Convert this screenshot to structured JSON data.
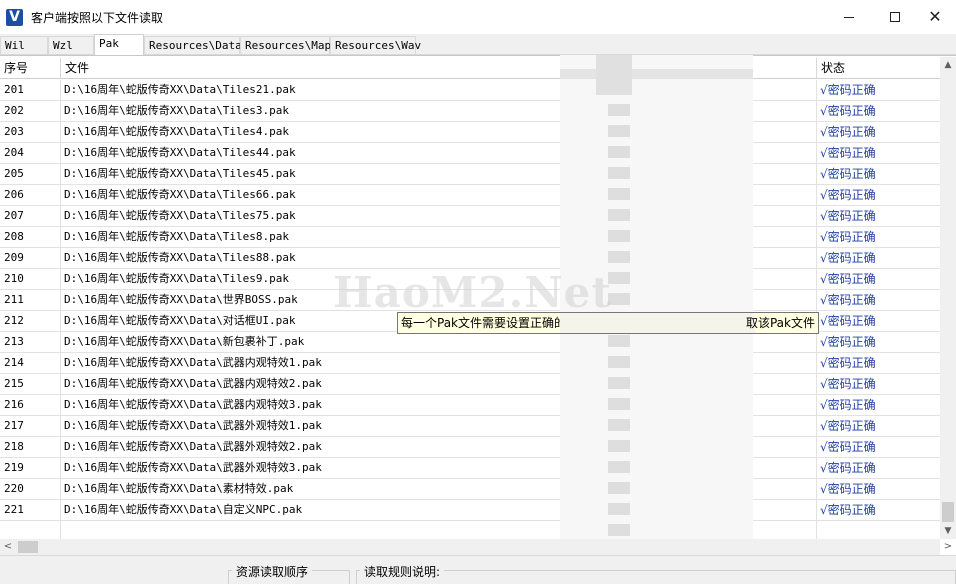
{
  "window": {
    "icon_letter": "V",
    "title": "客户端按照以下文件读取"
  },
  "tabs": [
    {
      "label": "Wil",
      "active": false
    },
    {
      "label": "Wzl",
      "active": false
    },
    {
      "label": "Pak",
      "active": true
    },
    {
      "label": "Resources\\Data",
      "active": false
    },
    {
      "label": "Resources\\Map",
      "active": false
    },
    {
      "label": "Resources\\Wav",
      "active": false
    }
  ],
  "table": {
    "headers": {
      "no": "序号",
      "file": "文件",
      "status": "状态"
    },
    "rows": [
      {
        "no": "201",
        "file": "D:\\16周年\\蛇版传奇XX\\Data\\Tiles21.pak",
        "status": "√密码正确"
      },
      {
        "no": "202",
        "file": "D:\\16周年\\蛇版传奇XX\\Data\\Tiles3.pak",
        "status": "√密码正确"
      },
      {
        "no": "203",
        "file": "D:\\16周年\\蛇版传奇XX\\Data\\Tiles4.pak",
        "status": "√密码正确"
      },
      {
        "no": "204",
        "file": "D:\\16周年\\蛇版传奇XX\\Data\\Tiles44.pak",
        "status": "√密码正确"
      },
      {
        "no": "205",
        "file": "D:\\16周年\\蛇版传奇XX\\Data\\Tiles45.pak",
        "status": "√密码正确"
      },
      {
        "no": "206",
        "file": "D:\\16周年\\蛇版传奇XX\\Data\\Tiles66.pak",
        "status": "√密码正确"
      },
      {
        "no": "207",
        "file": "D:\\16周年\\蛇版传奇XX\\Data\\Tiles75.pak",
        "status": "√密码正确"
      },
      {
        "no": "208",
        "file": "D:\\16周年\\蛇版传奇XX\\Data\\Tiles8.pak",
        "status": "√密码正确"
      },
      {
        "no": "209",
        "file": "D:\\16周年\\蛇版传奇XX\\Data\\Tiles88.pak",
        "status": "√密码正确"
      },
      {
        "no": "210",
        "file": "D:\\16周年\\蛇版传奇XX\\Data\\Tiles9.pak",
        "status": "√密码正确"
      },
      {
        "no": "211",
        "file": "D:\\16周年\\蛇版传奇XX\\Data\\世界BOSS.pak",
        "status": "√密码正确"
      },
      {
        "no": "212",
        "file": "D:\\16周年\\蛇版传奇XX\\Data\\对话框UI.pak",
        "status": "√密码正确"
      },
      {
        "no": "213",
        "file": "D:\\16周年\\蛇版传奇XX\\Data\\新包裹补丁.pak",
        "status": "√密码正确"
      },
      {
        "no": "214",
        "file": "D:\\16周年\\蛇版传奇XX\\Data\\武器内观特效1.pak",
        "status": "√密码正确"
      },
      {
        "no": "215",
        "file": "D:\\16周年\\蛇版传奇XX\\Data\\武器内观特效2.pak",
        "status": "√密码正确"
      },
      {
        "no": "216",
        "file": "D:\\16周年\\蛇版传奇XX\\Data\\武器内观特效3.pak",
        "status": "√密码正确"
      },
      {
        "no": "217",
        "file": "D:\\16周年\\蛇版传奇XX\\Data\\武器外观特效1.pak",
        "status": "√密码正确"
      },
      {
        "no": "218",
        "file": "D:\\16周年\\蛇版传奇XX\\Data\\武器外观特效2.pak",
        "status": "√密码正确"
      },
      {
        "no": "219",
        "file": "D:\\16周年\\蛇版传奇XX\\Data\\武器外观特效3.pak",
        "status": "√密码正确"
      },
      {
        "no": "220",
        "file": "D:\\16周年\\蛇版传奇XX\\Data\\素材特效.pak",
        "status": "√密码正确"
      },
      {
        "no": "221",
        "file": "D:\\16周年\\蛇版传奇XX\\Data\\自定义NPC.pak",
        "status": "√密码正确"
      }
    ]
  },
  "tooltip": {
    "left_text": "每一个Pak文件需要设置正确的",
    "right_text": "取该Pak文件"
  },
  "watermark": "HaoM2.Net",
  "bottom": {
    "group1_label": "资源读取顺序",
    "group2_label": "读取规则说明:"
  }
}
